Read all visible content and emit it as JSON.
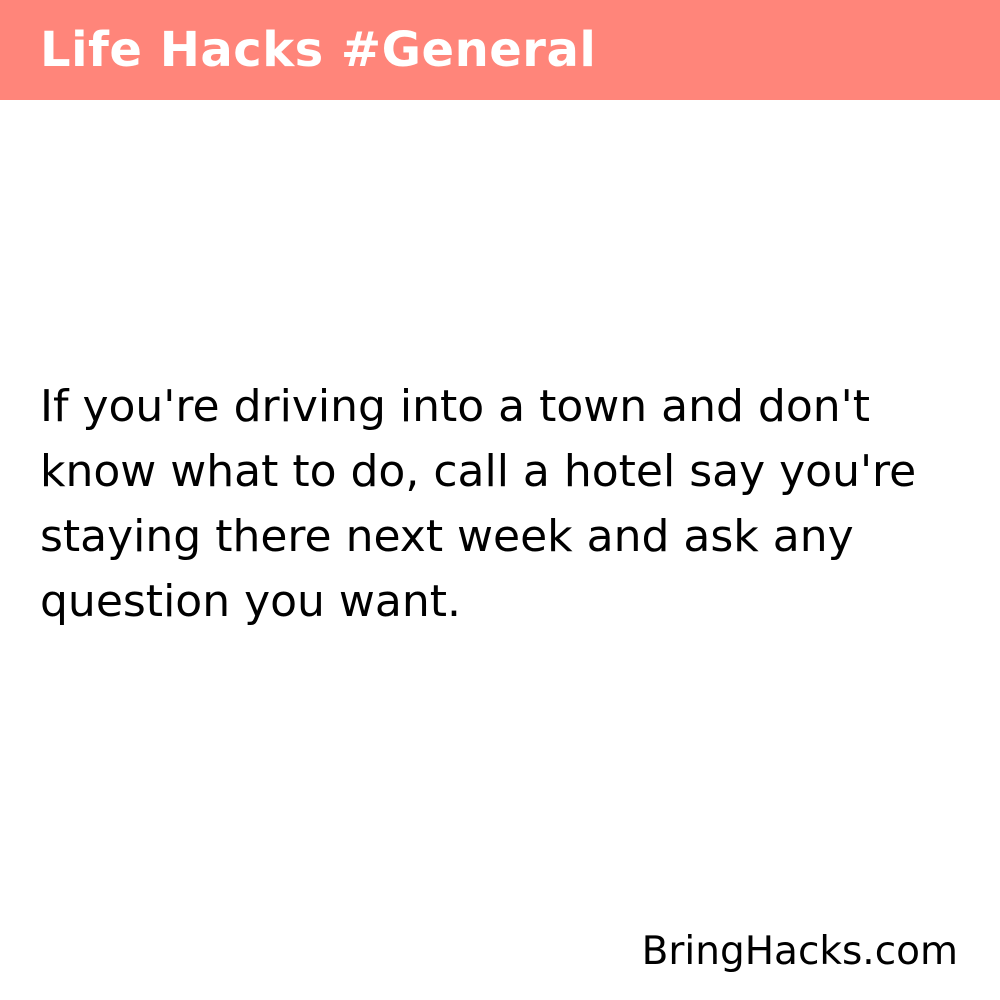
{
  "header": {
    "title": "Life Hacks #General",
    "background_color": "#ff857a",
    "text_color": "#ffffff"
  },
  "hack": {
    "text": "If you're driving into a town and don't know what to do, call a hotel say you're staying there next week and ask any question you want."
  },
  "footer": {
    "brand": "BringHacks.com"
  }
}
